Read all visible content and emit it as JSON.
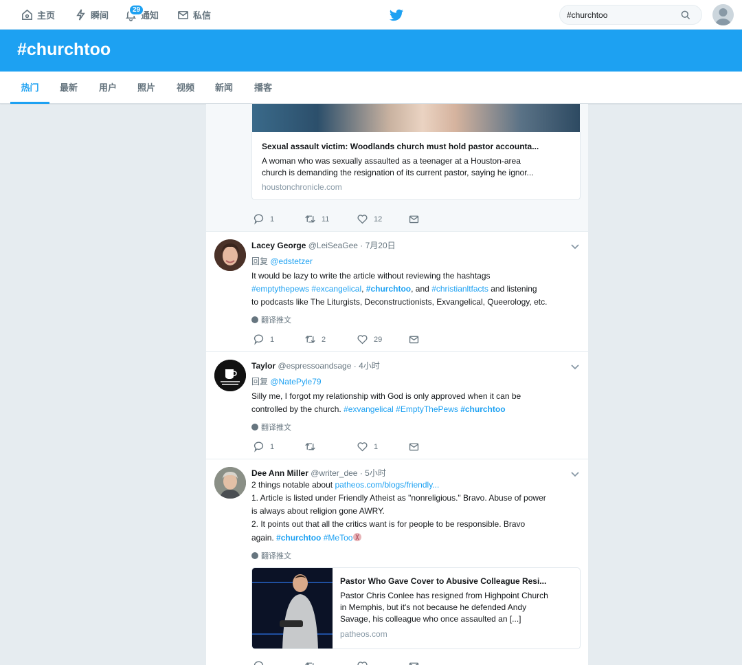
{
  "nav": {
    "home": "主页",
    "moments": "瞬间",
    "notifications": "通知",
    "notifications_count": "29",
    "messages": "私信"
  },
  "search": {
    "value": "#churchtoo"
  },
  "hero": {
    "title": "#churchtoo"
  },
  "tabs": [
    "热门",
    "最新",
    "用户",
    "照片",
    "视频",
    "新闻",
    "播客"
  ],
  "tweets": [
    {
      "card": {
        "title": "Sexual assault victim: Woodlands church must hold pastor accounta...",
        "desc1": "A woman who was sexually assaulted as a teenager at a Houston-area",
        "desc2": "church is demanding the resignation of its current pastor, saying he ignor...",
        "url": "houstonchronicle.com"
      },
      "replies": "1",
      "retweets": "11",
      "likes": "12"
    },
    {
      "name": "Lacey George",
      "handle": "@LeiSeaGee",
      "time": "· 7月20日",
      "reply_prefix": "回复",
      "reply_to": "@edstetzer",
      "l1": "It would be lazy to write the article without reviewing the hashtags",
      "tag1": "#emptythepews",
      "tag2": "#excangelical",
      "sep": ",",
      "tag3": "#churchtoo",
      "and": ", and",
      "tag4": "#christianltfacts",
      "l2_rest": " and listening",
      "l3": "to podcasts like The Liturgists, Deconstructionists, Exvangelical, Queerology, etc.",
      "translate": "翻译推文",
      "replies": "1",
      "retweets": "2",
      "likes": "29"
    },
    {
      "name": "Taylor",
      "handle": "@espressoandsage",
      "time": "· 4小时",
      "reply_prefix": "回复",
      "reply_to": "@NatePyle79",
      "l1": "Silly me, I forgot my relationship with God is only approved when it can be",
      "l2": "controlled by the church.",
      "tag1": "#exvangelical",
      "tag2": "#EmptyThePews",
      "tag3": "#churchtoo",
      "translate": "翻译推文",
      "replies": "1",
      "retweets": "",
      "likes": "1"
    },
    {
      "name": "Dee Ann Miller",
      "handle": "@writer_dee",
      "time": "· 5小时",
      "l1": "2 things notable about",
      "link": "patheos.com/blogs/friendly...",
      "l2": "1. Article is listed under Friendly Atheist as \"nonreligious.\" Bravo. Abuse of power",
      "l3": "is always about religion gone AWRY.",
      "l4": "2. It points out that all the critics want is for people to be responsible. Bravo",
      "l5": "again.",
      "tag1": "#churchtoo",
      "tag2": "#MeToo",
      "translate": "翻译推文",
      "card": {
        "title": "Pastor Who Gave Cover to Abusive Colleague Resi...",
        "desc1": "Pastor Chris Conlee has resigned from Highpoint Church",
        "desc2": "in Memphis, but it's not because he defended Andy",
        "desc3": "Savage, his colleague who once assaulted an [...]",
        "url": "patheos.com"
      }
    }
  ]
}
